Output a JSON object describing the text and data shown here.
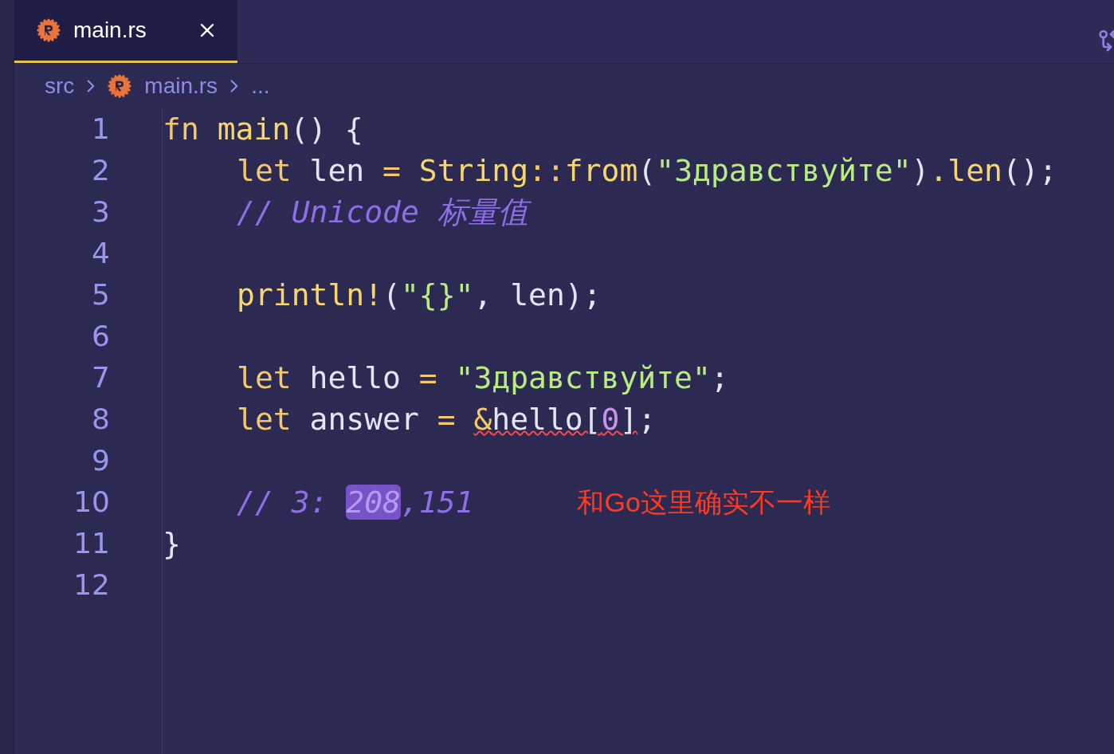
{
  "tabs": [
    {
      "label": "main.rs",
      "selected": true
    }
  ],
  "breadcrumb": {
    "folder": "src",
    "file": "main.rs",
    "rest": "..."
  },
  "lines": [
    {
      "number": "1",
      "indent": false,
      "tokens": [
        {
          "t": "fn ",
          "kind": "kw"
        },
        {
          "t": "main",
          "kind": "fn"
        },
        {
          "t": "() {",
          "kind": "plain"
        }
      ]
    },
    {
      "number": "2",
      "indent": true,
      "tokens": [
        {
          "t": "let ",
          "kind": "kw"
        },
        {
          "t": "len ",
          "kind": "plain"
        },
        {
          "t": "= ",
          "kind": "op"
        },
        {
          "t": "String",
          "kind": "type"
        },
        {
          "t": "::",
          "kind": "op"
        },
        {
          "t": "from",
          "kind": "fn"
        },
        {
          "t": "(",
          "kind": "plain"
        },
        {
          "t": "\"Здравствуйте\"",
          "kind": "str"
        },
        {
          "t": ")",
          "kind": "plain"
        },
        {
          "t": ".len",
          "kind": "fn"
        },
        {
          "t": "();",
          "kind": "plain"
        }
      ]
    },
    {
      "number": "3",
      "indent": true,
      "tokens": [
        {
          "t": "// Unicode 标量值",
          "kind": "comment"
        }
      ]
    },
    {
      "number": "4"
    },
    {
      "number": "5",
      "indent": true,
      "tokens": [
        {
          "t": "println!",
          "kind": "fn"
        },
        {
          "t": "(",
          "kind": "plain"
        },
        {
          "t": "\"{}\"",
          "kind": "str"
        },
        {
          "t": ", len);",
          "kind": "plain"
        }
      ]
    },
    {
      "number": "6"
    },
    {
      "number": "7",
      "indent": true,
      "tokens": [
        {
          "t": "let ",
          "kind": "kw"
        },
        {
          "t": "hello ",
          "kind": "plain"
        },
        {
          "t": "= ",
          "kind": "op"
        },
        {
          "t": "\"Здравствуйте\"",
          "kind": "str"
        },
        {
          "t": ";",
          "kind": "plain"
        }
      ]
    },
    {
      "number": "8",
      "indent": true,
      "tokens": [
        {
          "t": "let ",
          "kind": "kw"
        },
        {
          "t": "answer ",
          "kind": "plain"
        },
        {
          "t": "= ",
          "kind": "op"
        },
        {
          "t": "&",
          "kind": "err-op"
        },
        {
          "t": "hello[",
          "kind": "err-plain"
        },
        {
          "t": "0",
          "kind": "err-num"
        },
        {
          "t": "]",
          "kind": "err-plain"
        },
        {
          "t": ";",
          "kind": "plain"
        }
      ]
    },
    {
      "number": "9"
    },
    {
      "number": "10",
      "indent": true,
      "tokens": [
        {
          "t": "// 3: ",
          "kind": "comment"
        },
        {
          "t": "208",
          "kind": "comment-selected"
        },
        {
          "t": ",151",
          "kind": "comment"
        }
      ],
      "note": "和Go这里确实不一样"
    },
    {
      "number": "11",
      "indent": false,
      "tokens": [
        {
          "t": "}",
          "kind": "plain"
        }
      ]
    },
    {
      "number": "12"
    }
  ]
}
